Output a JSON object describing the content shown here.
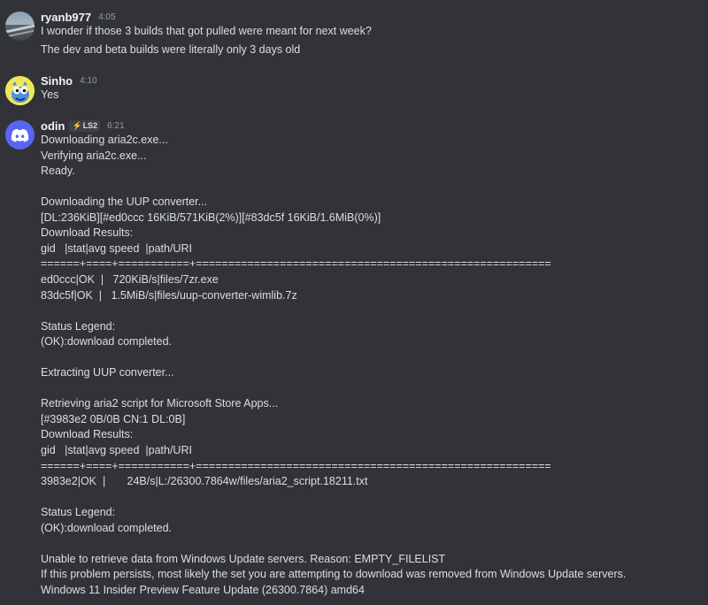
{
  "messages": [
    {
      "author": "ryanb977",
      "time": "4:05",
      "avatar_icon": "rail-photo-avatar",
      "lines": [
        "I wonder if those 3 builds that got pulled were meant for next week?",
        "The dev and beta builds were literally only 3 days old"
      ]
    },
    {
      "author": "Sinho",
      "time": "4:10",
      "avatar_icon": "yellow-creature-avatar",
      "lines": [
        "Yes"
      ]
    },
    {
      "author": "odin",
      "time": "6:21",
      "badge": "LS2",
      "avatar_icon": "discord-logo-avatar",
      "lines": [
        "Downloading aria2c.exe...",
        "Verifying aria2c.exe...",
        "Ready.",
        "",
        "Downloading the UUP converter...",
        "[DL:236KiB][#ed0ccc 16KiB/571KiB(2%)][#83dc5f 16KiB/1.6MiB(0%)]",
        "Download Results:",
        "gid   |stat|avg speed  |path/URI",
        "======+====+===========+=======================================================",
        "ed0ccc|OK  |   720KiB/s|files/7zr.exe",
        "83dc5f|OK  |   1.5MiB/s|files/uup-converter-wimlib.7z",
        "",
        "Status Legend:",
        "(OK):download completed.",
        "",
        "Extracting UUP converter...",
        "",
        "Retrieving aria2 script for Microsoft Store Apps...",
        "[#3983e2 0B/0B CN:1 DL:0B]",
        "Download Results:",
        "gid   |stat|avg speed  |path/URI",
        "======+====+===========+=======================================================",
        "3983e2|OK  |       24B/s|L:/26300.7864w/files/aria2_script.18211.txt",
        "",
        "Status Legend:",
        "(OK):download completed.",
        "",
        "Unable to retrieve data from Windows Update servers. Reason: EMPTY_FILELIST",
        "If this problem persists, most likely the set you are attempting to download was removed from Windows Update servers.",
        "Windows 11 Insider Preview Feature Update (26300.7864) amd64"
      ]
    }
  ]
}
